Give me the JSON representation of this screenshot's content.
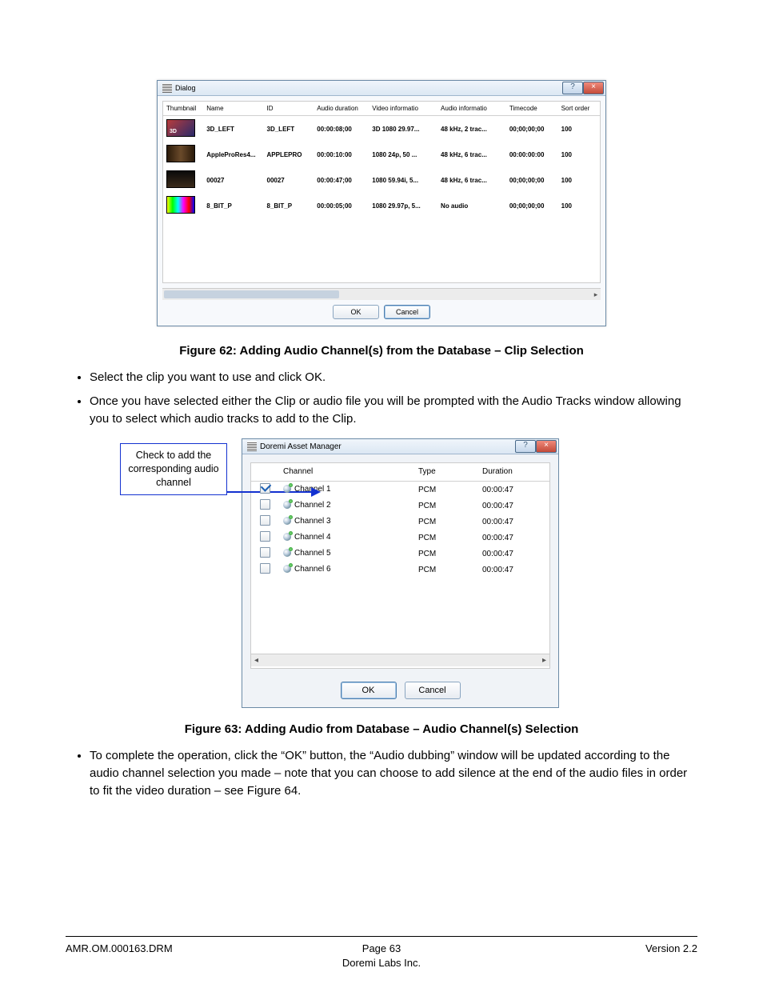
{
  "fig62": {
    "title": "Dialog",
    "help_glyph": "?",
    "close_glyph": "×",
    "columns": [
      "Thumbnail",
      "Name",
      "ID",
      "Audio duration",
      "Video informatio",
      "Audio informatio",
      "Timecode",
      "Sort order"
    ],
    "rows": [
      {
        "thumb": "i3d",
        "name": "3D_LEFT",
        "id": "3D_LEFT",
        "adur": "00:00:08;00",
        "vinfo": "3D 1080 29.97...",
        "ainfo": "48 kHz, 2 trac...",
        "tc": "00;00;00;00",
        "sort": "100"
      },
      {
        "thumb": "iapp",
        "name": "AppleProRes4...",
        "id": "APPLEPRO",
        "adur": "00:00:10:00",
        "vinfo": "1080 24p, 50 ...",
        "ainfo": "48 kHz, 6 trac...",
        "tc": "00:00:00:00",
        "sort": "100"
      },
      {
        "thumb": "i002",
        "name": "00027",
        "id": "00027",
        "adur": "00:00:47;00",
        "vinfo": "1080 59.94i, 5...",
        "ainfo": "48 kHz, 6 trac...",
        "tc": "00;00;00;00",
        "sort": "100"
      },
      {
        "thumb": "i8b",
        "name": "8_BIT_P",
        "id": "8_BIT_P",
        "adur": "00:00:05;00",
        "vinfo": "1080 29.97p, 5...",
        "ainfo": "No audio",
        "tc": "00;00;00;00",
        "sort": "100"
      }
    ],
    "ok": "OK",
    "cancel": "Cancel",
    "caption": "Figure 62: Adding Audio Channel(s) from the Database – Clip Selection"
  },
  "bullets1": [
    "Select the clip you want to use and click OK.",
    "Once you have selected either the Clip or audio file you will be prompted with the Audio Tracks window allowing you to select which audio tracks to add to the Clip."
  ],
  "callout": "Check to add the corresponding audio channel",
  "fig63": {
    "title": "Doremi Asset Manager",
    "help_glyph": "?",
    "close_glyph": "×",
    "columns": [
      "",
      "Channel",
      "Type",
      "Duration"
    ],
    "rows": [
      {
        "checked": true,
        "ch": "Channel 1",
        "type": "PCM",
        "dur": "00:00:47"
      },
      {
        "checked": false,
        "ch": "Channel 2",
        "type": "PCM",
        "dur": "00:00:47"
      },
      {
        "checked": false,
        "ch": "Channel 3",
        "type": "PCM",
        "dur": "00:00:47"
      },
      {
        "checked": false,
        "ch": "Channel 4",
        "type": "PCM",
        "dur": "00:00:47"
      },
      {
        "checked": false,
        "ch": "Channel 5",
        "type": "PCM",
        "dur": "00:00:47"
      },
      {
        "checked": false,
        "ch": "Channel 6",
        "type": "PCM",
        "dur": "00:00:47"
      }
    ],
    "ok": "OK",
    "cancel": "Cancel",
    "caption": "Figure 63: Adding Audio from Database – Audio Channel(s) Selection"
  },
  "bullets2": [
    "To complete the operation, click the “OK” button, the “Audio dubbing” window will be updated according to the audio channel selection you made – note that you can choose to add silence at the end of the audio files in order to fit the video duration – see Figure 64."
  ],
  "footer": {
    "left": "AMR.OM.000163.DRM",
    "page": "Page 63",
    "org": "Doremi Labs Inc.",
    "right": "Version 2.2"
  }
}
